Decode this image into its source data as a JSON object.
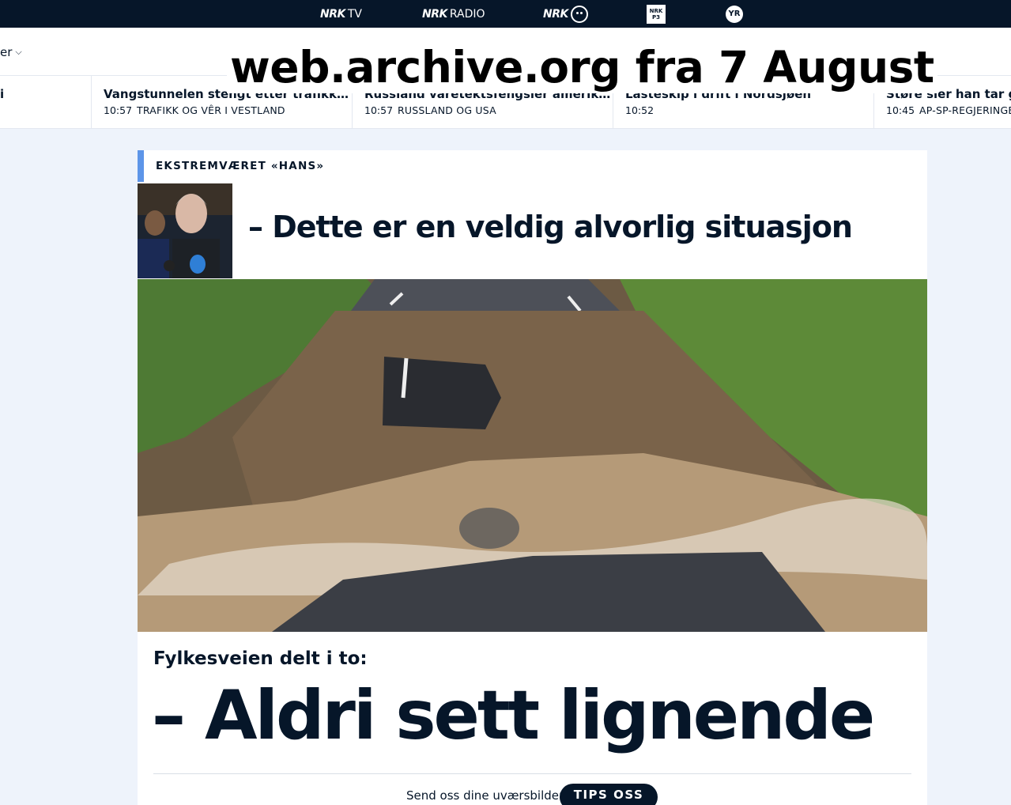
{
  "topnav": {
    "tv": {
      "logo": "NRK",
      "label": "TV"
    },
    "radio": {
      "logo": "NRK",
      "label": "RADIO"
    },
    "super": {
      "logo": "NRK"
    },
    "p3": {
      "label": "NRK P3"
    },
    "yr": {
      "label": "YR"
    }
  },
  "header": {
    "menu_fragment": "er",
    "archive_note": "web.archive.org fra 7 August"
  },
  "ticker": [
    {
      "title": "i",
      "time": "",
      "category": ""
    },
    {
      "title": "Vangstunnelen stengt etter trafikk…",
      "time": "10:57",
      "category": "TRAFIKK OG VÊR I VESTLAND"
    },
    {
      "title": "Russland varetektsfengsler amerik…",
      "time": "10:57",
      "category": "RUSSLAND OG USA"
    },
    {
      "title": "Lasteskip i drift i Nordsjøen",
      "time": "10:52",
      "category": ""
    },
    {
      "title": "Støre sier han tar gjen",
      "time": "10:45",
      "category": "AP-SP-REGJERINGEN"
    }
  ],
  "article": {
    "kicker": "EKSTREMVÆRET «HANS»",
    "headline1": "– Dette er en veldig alvorlig situasjon",
    "kicker2": "Fylkesveien delt i to:",
    "headline2": "– Aldri sett lignende",
    "cta_text": "Send oss dine uværsbilder",
    "cta_button": "TIPS OSS"
  },
  "colors": {
    "nav_bg": "#061629",
    "accent": "#5d95e8",
    "page_bg": "#eef3fb"
  }
}
